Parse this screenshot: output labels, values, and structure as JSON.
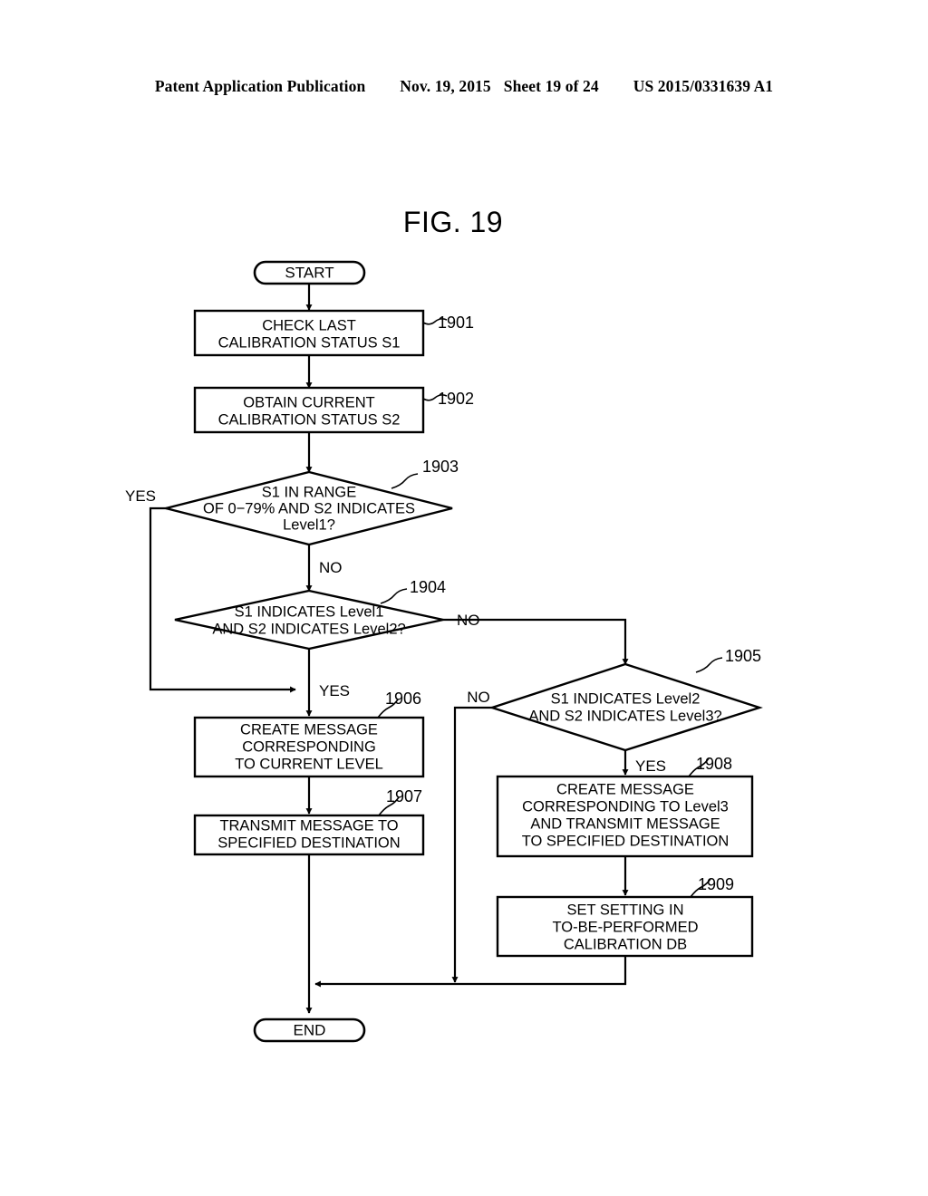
{
  "header": {
    "publication": "Patent Application Publication",
    "date": "Nov. 19, 2015",
    "sheet": "Sheet 19 of 24",
    "patent_number": "US 2015/0331639 A1"
  },
  "figure": {
    "title": "FIG. 19"
  },
  "flowchart": {
    "start": {
      "label": "START"
    },
    "end": {
      "label": "END"
    },
    "steps": {
      "s1901": {
        "ref": "1901",
        "line1": "CHECK LAST",
        "line2": "CALIBRATION STATUS S1"
      },
      "s1902": {
        "ref": "1902",
        "line1": "OBTAIN CURRENT",
        "line2": "CALIBRATION STATUS S2"
      },
      "s1903": {
        "ref": "1903",
        "line1": "S1 IN RANGE",
        "line2": "OF 0−79% AND S2 INDICATES",
        "line3": "Level1?",
        "yes_label": "YES",
        "no_label": "NO"
      },
      "s1904": {
        "ref": "1904",
        "line1": "S1 INDICATES Level1",
        "line2": "AND S2 INDICATES Level2?",
        "yes_label": "YES",
        "no_label": "NO"
      },
      "s1905": {
        "ref": "1905",
        "line1": "S1 INDICATES Level2",
        "line2": "AND S2 INDICATES Level3?",
        "yes_label": "YES",
        "no_label": "NO"
      },
      "s1906": {
        "ref": "1906",
        "line1": "CREATE MESSAGE",
        "line2": "CORRESPONDING",
        "line3": "TO CURRENT LEVEL"
      },
      "s1907": {
        "ref": "1907",
        "line1": "TRANSMIT MESSAGE TO",
        "line2": "SPECIFIED DESTINATION"
      },
      "s1908": {
        "ref": "1908",
        "line1": "CREATE MESSAGE",
        "line2": "CORRESPONDING TO Level3",
        "line3": "AND TRANSMIT MESSAGE",
        "line4": "TO SPECIFIED DESTINATION"
      },
      "s1909": {
        "ref": "1909",
        "line1": "SET SETTING IN",
        "line2": "TO-BE-PERFORMED",
        "line3": "CALIBRATION DB"
      }
    }
  },
  "colors": {
    "ink": "#000000",
    "paper": "#ffffff"
  }
}
